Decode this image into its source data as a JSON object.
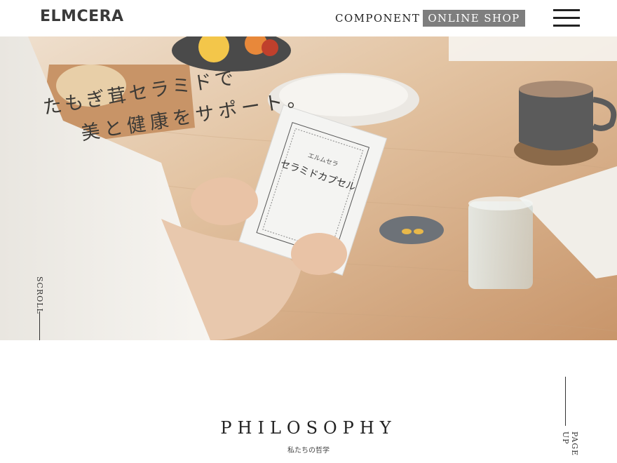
{
  "header": {
    "logo": "ELMCERA",
    "nav_component": "COMPONENT",
    "nav_shop": "ONLINE SHOP",
    "menu_icon": "hamburger-menu-icon"
  },
  "hero": {
    "catch_line1": "たもぎ茸セラミドで",
    "catch_line2": "美と健康をサポート。",
    "scroll_label": "SCROLL",
    "package_brand": "エルムセラ",
    "package_name": "セラミドカプセル"
  },
  "philosophy": {
    "title": "PHILOSOPHY",
    "subtitle": "私たちの哲学",
    "page_up": "PAGE UP"
  },
  "colors": {
    "shop_button": "#7e7e7e",
    "header_bg": "#ffffff",
    "table_wood": "#d9b48e"
  }
}
